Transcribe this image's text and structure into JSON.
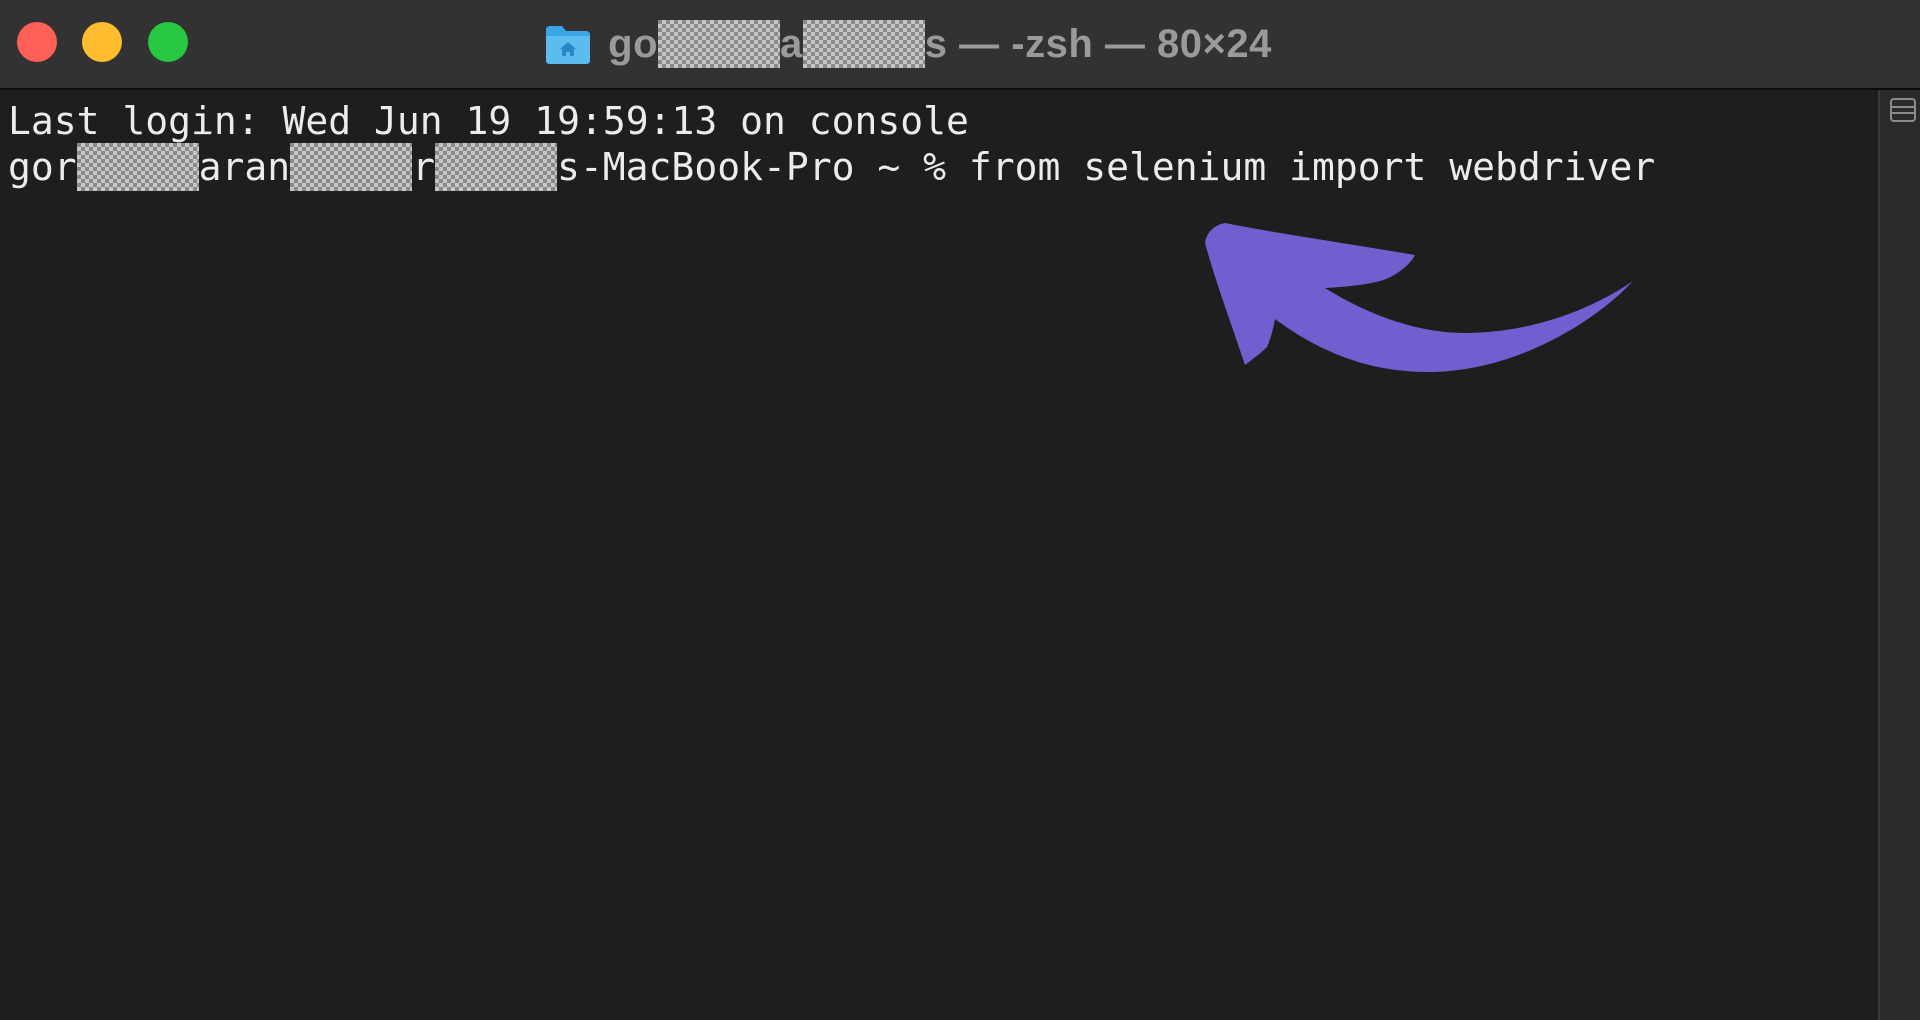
{
  "window": {
    "title_prefix": "go",
    "title_middle": "a",
    "title_suffix": "s — -zsh — 80×24",
    "folder_icon": "home-folder-icon",
    "colors": {
      "close": "#fe5f57",
      "minimize": "#febc2e",
      "zoom": "#28c840",
      "annotation_arrow": "#6f5fcf"
    }
  },
  "terminal": {
    "last_login": "Last login: Wed Jun 19 19:59:13 on console",
    "prompt_part1": "gor",
    "prompt_part2": "aran",
    "prompt_part3": "r",
    "prompt_part4": "s-MacBook-Pro ~ % ",
    "command": "from selenium import webdriver"
  },
  "annotation": {
    "icon": "curved-arrow-icon"
  }
}
